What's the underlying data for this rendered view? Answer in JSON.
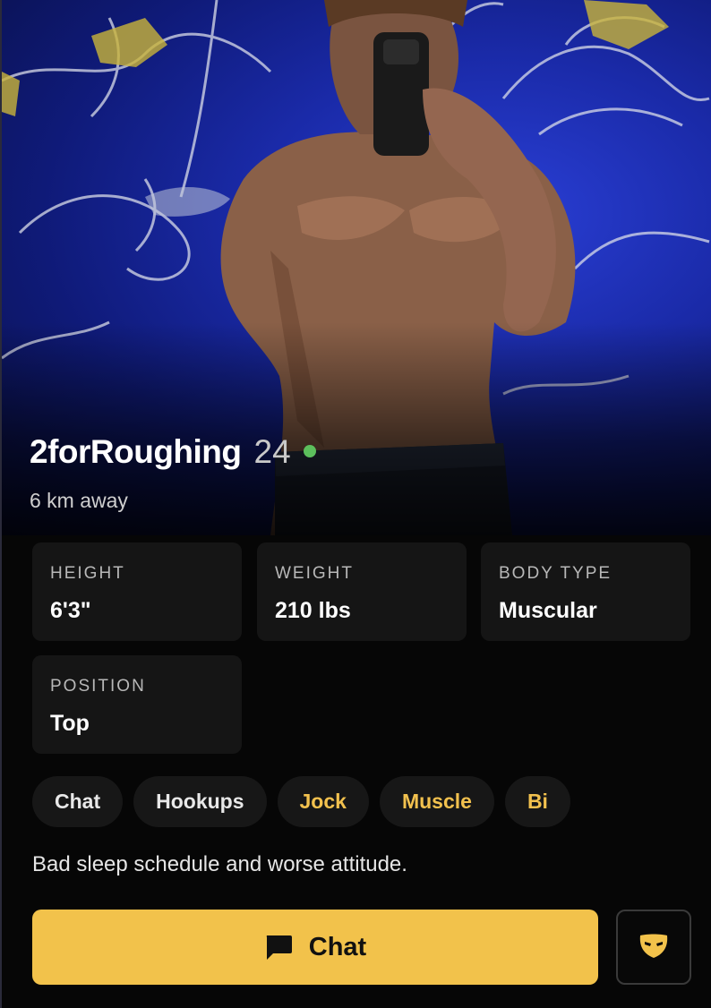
{
  "profile": {
    "name": "2forRoughing",
    "age": "24",
    "distance": "6 km away",
    "online": true,
    "online_color": "#5cbf5c"
  },
  "stats": [
    {
      "label": "HEIGHT",
      "value": "6'3\""
    },
    {
      "label": "WEIGHT",
      "value": "210 lbs"
    },
    {
      "label": "BODY TYPE",
      "value": "Muscular"
    },
    {
      "label": "POSITION",
      "value": "Top"
    }
  ],
  "tags": [
    {
      "label": "Chat",
      "accent": false
    },
    {
      "label": "Hookups",
      "accent": false
    },
    {
      "label": "Jock",
      "accent": true
    },
    {
      "label": "Muscle",
      "accent": true
    },
    {
      "label": "Bi",
      "accent": true
    }
  ],
  "bio": "Bad sleep schedule and worse attitude.",
  "actions": {
    "chat_label": "Chat",
    "chat_icon": "chat-bubble-icon",
    "mask_icon": "grindr-mask-icon"
  },
  "colors": {
    "accent": "#f2c24b",
    "background": "#060606",
    "card": "#151515"
  }
}
